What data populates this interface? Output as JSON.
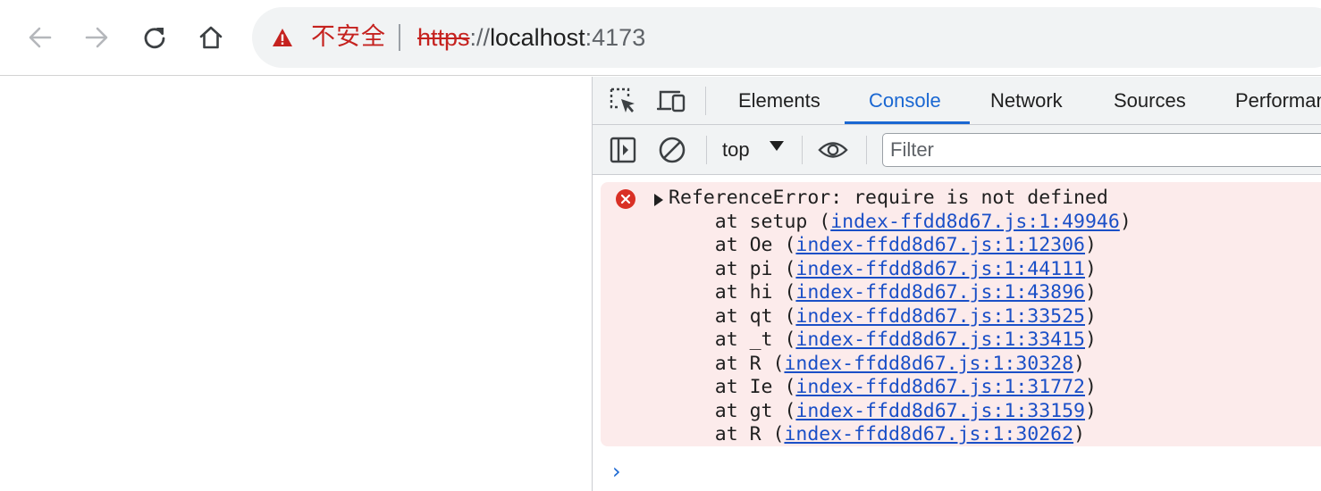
{
  "browser": {
    "security_label": "不安全",
    "url": {
      "scheme": "https",
      "separator": "://",
      "host": "localhost",
      "port": ":4173"
    }
  },
  "devtools": {
    "tabs": [
      {
        "label": "Elements",
        "active": false
      },
      {
        "label": "Console",
        "active": true
      },
      {
        "label": "Network",
        "active": false
      },
      {
        "label": "Sources",
        "active": false
      },
      {
        "label": "Performance",
        "active": false
      }
    ],
    "console_toolbar": {
      "context": "top",
      "filter_placeholder": "Filter"
    },
    "error": {
      "title": "ReferenceError: require is not defined",
      "frames": [
        {
          "fn": "setup",
          "src": "index-ffdd8d67.js:1:49946"
        },
        {
          "fn": "Oe",
          "src": "index-ffdd8d67.js:1:12306"
        },
        {
          "fn": "pi",
          "src": "index-ffdd8d67.js:1:44111"
        },
        {
          "fn": "hi",
          "src": "index-ffdd8d67.js:1:43896"
        },
        {
          "fn": "qt",
          "src": "index-ffdd8d67.js:1:33525"
        },
        {
          "fn": "_t",
          "src": "index-ffdd8d67.js:1:33415"
        },
        {
          "fn": "R",
          "src": "index-ffdd8d67.js:1:30328"
        },
        {
          "fn": "Ie",
          "src": "index-ffdd8d67.js:1:31772"
        },
        {
          "fn": "gt",
          "src": "index-ffdd8d67.js:1:33159"
        },
        {
          "fn": "R",
          "src": "index-ffdd8d67.js:1:30262"
        }
      ]
    },
    "prompt_symbol": "›"
  },
  "colors": {
    "accent": "#1a67d2",
    "error_bg": "#fcebeb",
    "error_red": "#d93025",
    "insecure_red": "#c5221f",
    "link": "#1a4fc7"
  },
  "icons": [
    "back-arrow-icon",
    "forward-arrow-icon",
    "reload-icon",
    "home-icon",
    "warning-icon",
    "inspect-element-icon",
    "device-toolbar-icon",
    "sidebar-toggle-icon",
    "clear-console-icon",
    "eye-icon",
    "error-icon"
  ]
}
